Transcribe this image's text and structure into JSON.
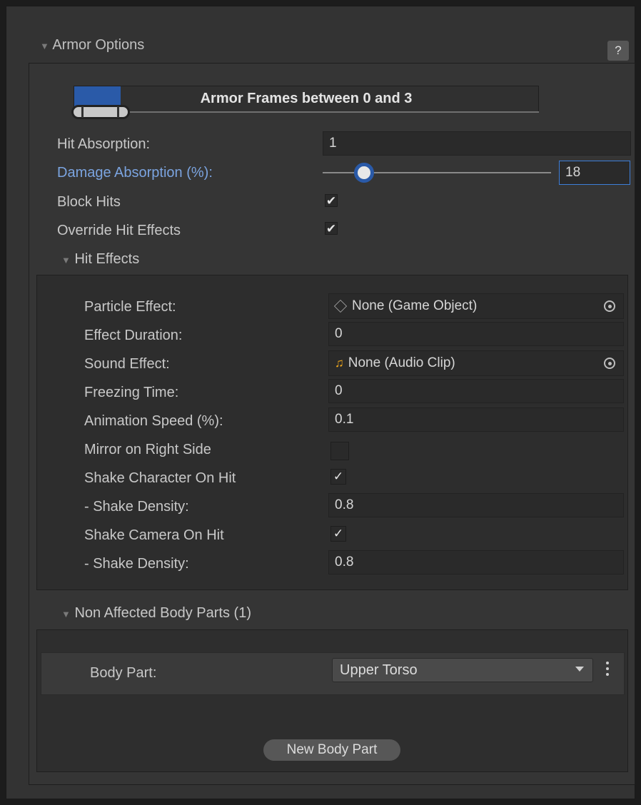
{
  "header": {
    "title": "Armor Options",
    "help_label": "?"
  },
  "armor_frames": {
    "label": "Armor Frames between 0 and 3",
    "fill_fraction": 0.1
  },
  "fields": {
    "hit_absorption": {
      "label": "Hit Absorption:",
      "value": "1"
    },
    "damage_absorption": {
      "label": "Damage Absorption (%):",
      "value": "18",
      "slider_fraction": 0.18
    },
    "block_hits": {
      "label": "Block Hits",
      "checked": true,
      "check_glyph": "✔"
    },
    "override_hit_effects": {
      "label": "Override Hit Effects",
      "checked": true,
      "check_glyph": "✔"
    }
  },
  "hit_effects": {
    "title": "Hit Effects",
    "particle_effect": {
      "label": "Particle Effect:",
      "value": "None (Game Object)"
    },
    "effect_duration": {
      "label": "Effect Duration:",
      "value": "0"
    },
    "sound_effect": {
      "label": "Sound Effect:",
      "value": "None (Audio Clip)",
      "icon_color": "#f0a81c"
    },
    "freezing_time": {
      "label": "Freezing Time:",
      "value": "0"
    },
    "animation_speed": {
      "label": "Animation Speed (%):",
      "value": "0.1"
    },
    "mirror_on_right_side": {
      "label": "Mirror on Right Side",
      "checked": false
    },
    "shake_character_on_hit": {
      "label": "Shake Character On Hit",
      "checked": true,
      "check_glyph": "✓"
    },
    "shake_density_character": {
      "label": "- Shake Density:",
      "value": "0.8"
    },
    "shake_camera_on_hit": {
      "label": "Shake Camera On Hit",
      "checked": true,
      "check_glyph": "✓"
    },
    "shake_density_camera": {
      "label": "- Shake Density:",
      "value": "0.8"
    }
  },
  "non_affected": {
    "title": "Non Affected Body Parts (1)",
    "body_part": {
      "label": "Body Part:",
      "value": "Upper Torso"
    },
    "new_button": "New Body Part"
  },
  "colors": {
    "accent": "#7ba4e0",
    "frame_fill": "#2a5aa8"
  }
}
